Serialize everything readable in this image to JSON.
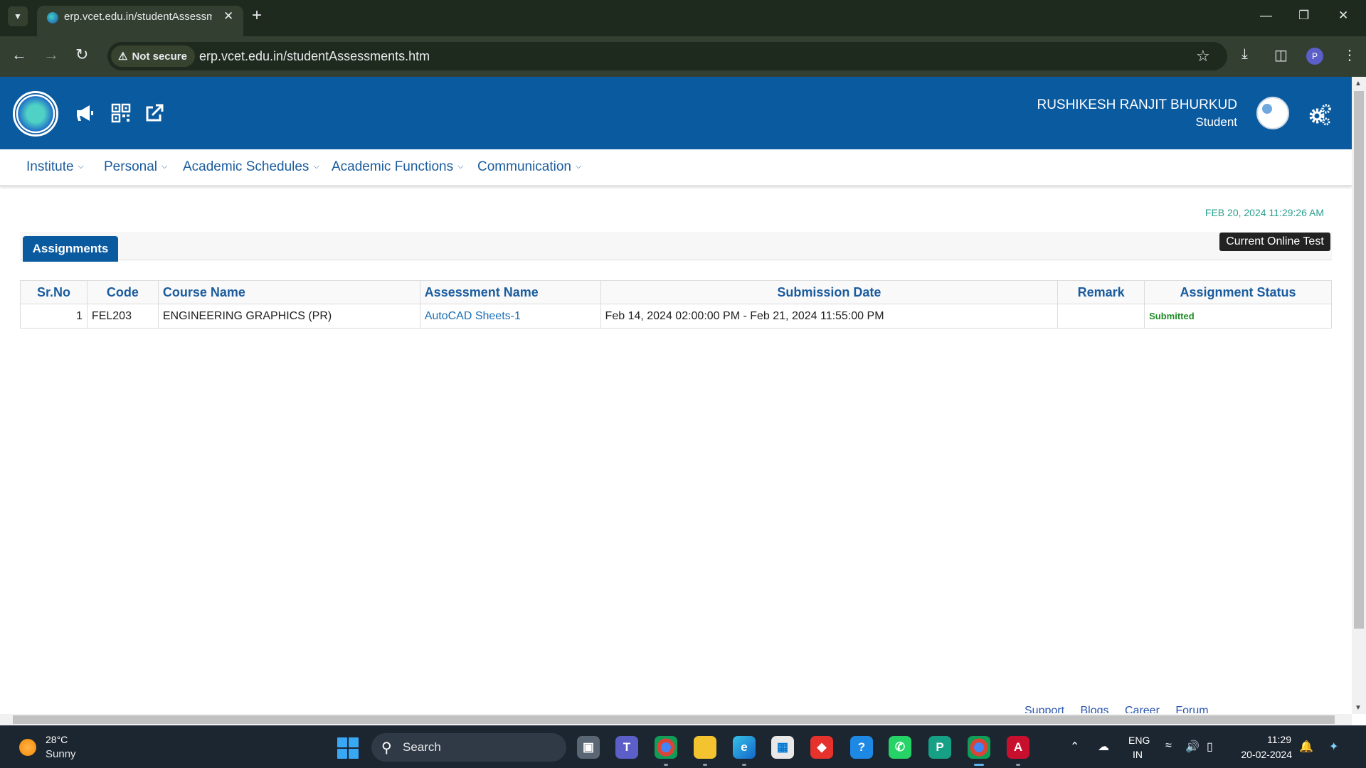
{
  "browser": {
    "tab_title": "erp.vcet.edu.in/studentAssessm",
    "security_label": "Not secure",
    "url": "erp.vcet.edu.in/studentAssessments.htm",
    "profile_initial": "P"
  },
  "header": {
    "user_name": "RUSHIKESH RANJIT BHURKUD",
    "user_role": "Student"
  },
  "menu": [
    {
      "label": "Institute"
    },
    {
      "label": "Personal"
    },
    {
      "label": "Academic Schedules"
    },
    {
      "label": "Academic Functions"
    },
    {
      "label": "Communication"
    }
  ],
  "datetime": "FEB 20, 2024   11:29:26 AM",
  "tabs": {
    "active_label": "Assignments",
    "online_test_label": "Current Online Test"
  },
  "table": {
    "columns": [
      "Sr.No",
      "Code",
      "Course Name",
      "Assessment Name",
      "Submission Date",
      "Remark",
      "Assignment Status"
    ],
    "rows": [
      {
        "sr_no": "1",
        "code": "FEL203",
        "course_name": "ENGINEERING GRAPHICS (PR)",
        "assessment_name": "AutoCAD Sheets-1",
        "submission_date": "Feb 14, 2024 02:00:00 PM - Feb 21, 2024 11:55:00 PM",
        "remark": "",
        "status": "Submitted"
      }
    ]
  },
  "footer_links": [
    "Support",
    "Blogs",
    "Career",
    "Forum"
  ],
  "taskbar": {
    "weather_temp": "28°C",
    "weather_desc": "Sunny",
    "search_label": "Search",
    "lang_line1": "ENG",
    "lang_line2": "IN",
    "time": "11:29",
    "date": "20-02-2024"
  },
  "colors": {
    "header_bg": "#0a5aa0",
    "menu_text": "#1b5c9e",
    "datetime": "#2aa08f",
    "status_submitted": "#1e8c26"
  }
}
